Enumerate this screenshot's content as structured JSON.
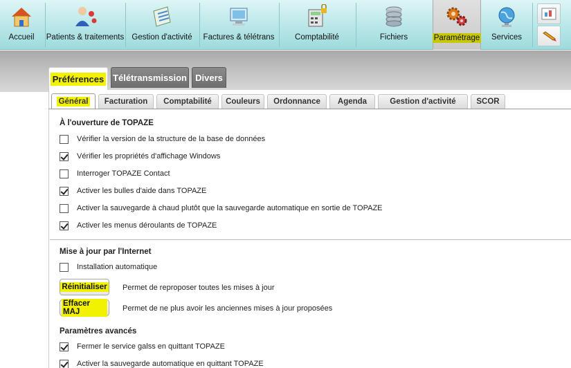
{
  "toolbar": {
    "items": [
      {
        "label": "Accueil",
        "icon": "house-icon"
      },
      {
        "label": "Patients & traitements",
        "icon": "patients-icon"
      },
      {
        "label": "Gestion d'activité",
        "icon": "activity-book-icon"
      },
      {
        "label": "Factures & télétrans",
        "icon": "invoice-computer-icon"
      },
      {
        "label": "Comptabilité",
        "icon": "calculator-lock-icon"
      },
      {
        "label": "Fichiers",
        "icon": "database-icon"
      },
      {
        "label": "Paramétrage",
        "icon": "gears-icon"
      },
      {
        "label": "Services",
        "icon": "globe-icon"
      }
    ],
    "highlight_color": "#c8c800"
  },
  "outer_tabs": [
    "Préférences",
    "Télétransmission",
    "Divers"
  ],
  "inner_tabs": [
    "Général",
    "Facturation",
    "Comptabilité",
    "Couleurs",
    "Ordonnance",
    "Agenda",
    "Gestion d'activité",
    "SCOR"
  ],
  "sections": {
    "startup": {
      "title": "À l'ouverture de TOPAZE",
      "options": [
        {
          "label": "Vérifier la version de la structure de la base de données",
          "checked": false
        },
        {
          "label": "Vérifier les propriétés d'affichage Windows",
          "checked": true
        },
        {
          "label": "Interroger TOPAZE Contact",
          "checked": false
        },
        {
          "label": "Activer les bulles d'aide dans TOPAZE",
          "checked": true
        },
        {
          "label": "Activer la sauvegarde à chaud plutôt que la sauvegarde automatique en sortie de TOPAZE",
          "checked": false
        },
        {
          "label": "Activer les menus déroulants de TOPAZE",
          "checked": true
        }
      ]
    },
    "update": {
      "title": "Mise à jour par l'Internet",
      "auto_install": {
        "label": "Installation automatique",
        "checked": false
      },
      "reset_button": "Réinitialiser",
      "reset_desc": "Permet de reproposer toutes les mises à jour",
      "clear_button": "Effacer MAJ",
      "clear_desc": "Permet de ne plus avoir les anciennes mises à jour proposées"
    },
    "advanced": {
      "title": "Paramètres avancés",
      "options": [
        {
          "label": "Fermer le service galss en quittant TOPAZE",
          "checked": true
        },
        {
          "label": "Activer la sauvegarde automatique en quittant TOPAZE",
          "checked": true
        }
      ]
    }
  },
  "colors": {
    "toolbar_top": "#dff5f6",
    "toolbar_bottom": "#9edbdd",
    "highlight": "#f2f200"
  }
}
